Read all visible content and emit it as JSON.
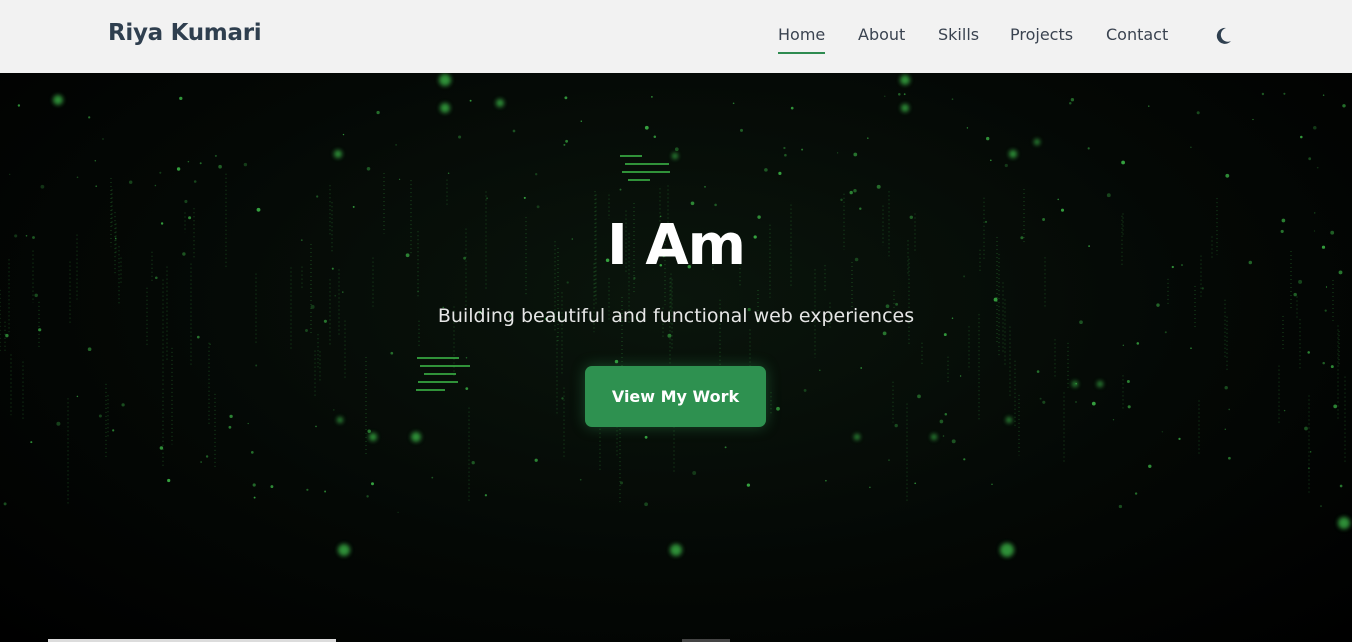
{
  "navbar": {
    "brand": "Riya Kumari",
    "links": [
      {
        "label": "Home",
        "active": true
      },
      {
        "label": "About",
        "active": false
      },
      {
        "label": "Skills",
        "active": false
      },
      {
        "label": "Projects",
        "active": false
      },
      {
        "label": "Contact",
        "active": false
      }
    ],
    "theme_toggle_icon": "moon-icon"
  },
  "hero": {
    "title": "I Am",
    "subtitle": "Building beautiful and functional web experiences",
    "cta_label": "View My Work"
  },
  "colors": {
    "accent": "#2e9150",
    "nav_bg": "#f2f2f2",
    "brand_text": "#2f3f4f",
    "hero_bg": "#000000",
    "particle": "#3fbf4a"
  }
}
